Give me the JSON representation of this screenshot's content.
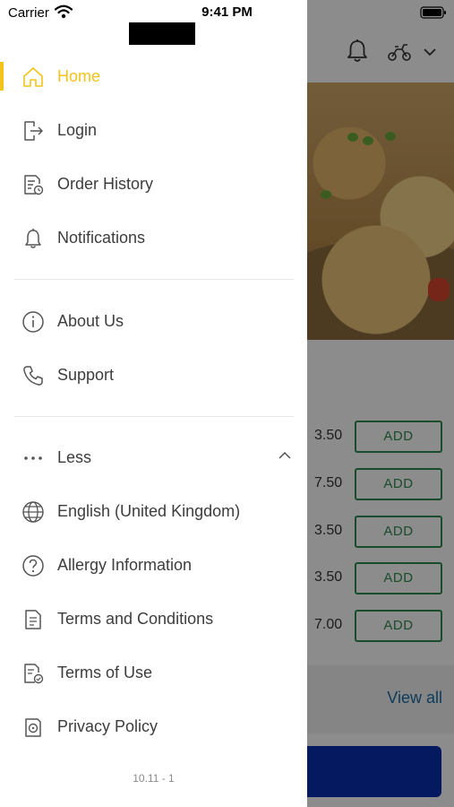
{
  "status_bar": {
    "carrier": "Carrier",
    "time": "9:41 PM",
    "wifi_icon": "wifi-icon",
    "battery_icon": "battery-icon"
  },
  "drawer": {
    "nav_items": [
      {
        "label": "Home",
        "icon": "home-icon",
        "active": true
      },
      {
        "label": "Login",
        "icon": "login-icon"
      },
      {
        "label": "Order History",
        "icon": "order-history-icon"
      },
      {
        "label": "Notifications",
        "icon": "bell-icon"
      },
      {
        "label": "About Us",
        "icon": "info-icon"
      },
      {
        "label": "Support",
        "icon": "phone-icon"
      },
      {
        "label": "Less",
        "icon": "more-dots-icon"
      },
      {
        "label": "English (United Kingdom)",
        "icon": "globe-icon"
      },
      {
        "label": "Allergy Information",
        "icon": "question-icon"
      },
      {
        "label": "Terms and Conditions",
        "icon": "document-icon"
      },
      {
        "label": "Terms of Use",
        "icon": "document-check-icon"
      },
      {
        "label": "Privacy Policy",
        "icon": "privacy-icon"
      }
    ],
    "version": "10.11 - 1",
    "accent_color": "#f2c318"
  },
  "background": {
    "header_icons": [
      "bell-icon",
      "delivery-scooter-icon",
      "chevron-down-icon"
    ],
    "menu_rows": [
      {
        "price": "3.50",
        "button": "ADD"
      },
      {
        "price": "7.50",
        "button": "ADD"
      },
      {
        "price": "3.50",
        "button": "ADD"
      },
      {
        "price": "3.50",
        "button": "ADD"
      },
      {
        "price": "7.00",
        "button": "ADD"
      }
    ],
    "view_all": "View all",
    "checkout_color": "#0a2fb0",
    "add_button_color": "#2f8a4f",
    "link_color": "#1a6ca8"
  }
}
